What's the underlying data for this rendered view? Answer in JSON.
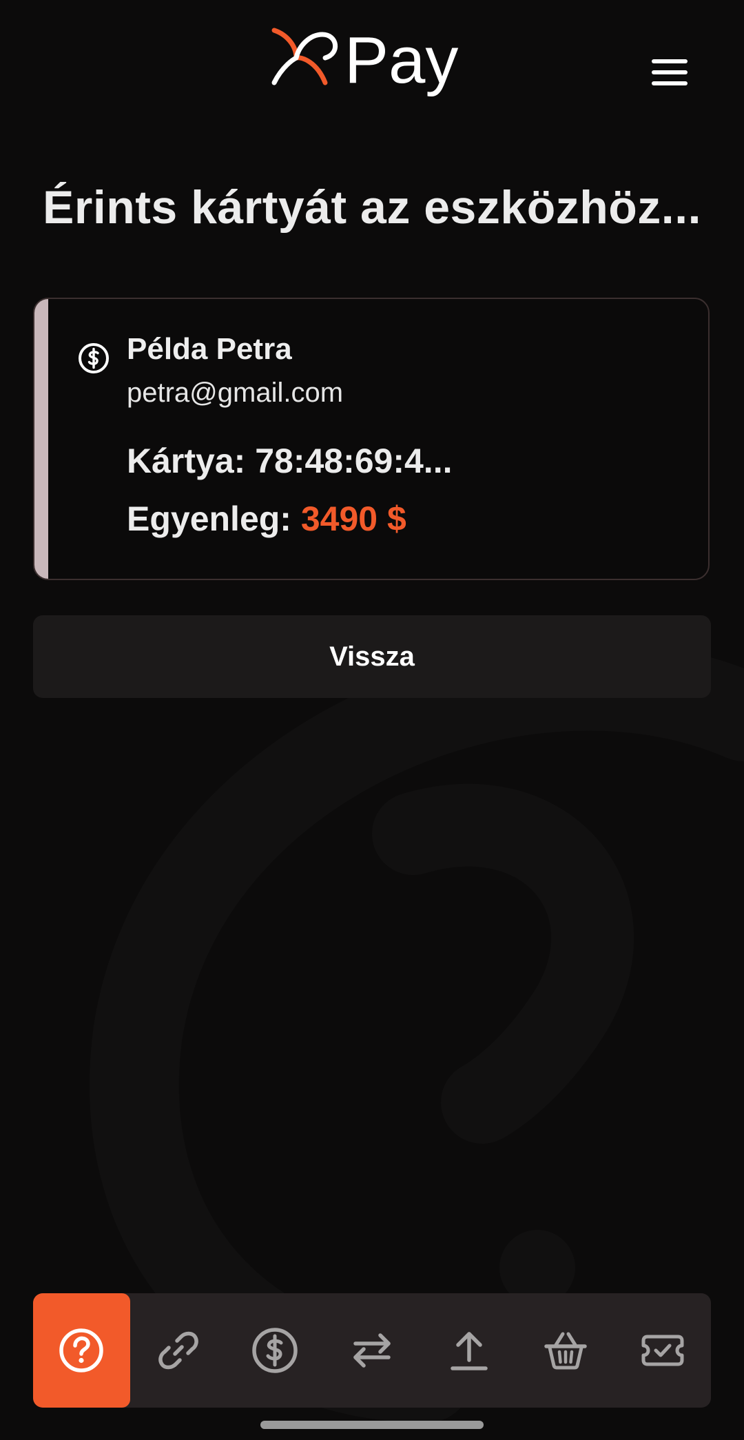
{
  "header": {
    "logo_icon": "xrpay-logo",
    "logo_text": "Pay",
    "menu_icon": "hamburger-menu-icon",
    "accent_color": "#f25a2a"
  },
  "main": {
    "title": "Érints kártyát az eszközhöz..."
  },
  "card": {
    "icon": "dollar-circle-icon",
    "name": "Példa Petra",
    "email": "petra@gmail.com",
    "card_label": "Kártya:",
    "card_value": "78:48:69:4...",
    "balance_label": "Egyenleg:",
    "balance_value": "3490 $",
    "accent_bar_color": "#c9b8bb"
  },
  "actions": {
    "back_label": "Vissza"
  },
  "bottom_nav": {
    "items": [
      {
        "icon": "help-circle-icon",
        "active": true
      },
      {
        "icon": "link-icon",
        "active": false
      },
      {
        "icon": "dollar-circle-icon",
        "active": false
      },
      {
        "icon": "transfer-arrows-icon",
        "active": false
      },
      {
        "icon": "upload-icon",
        "active": false
      },
      {
        "icon": "basket-icon",
        "active": false
      },
      {
        "icon": "ticket-check-icon",
        "active": false
      }
    ],
    "active_color": "#f25a2a"
  }
}
